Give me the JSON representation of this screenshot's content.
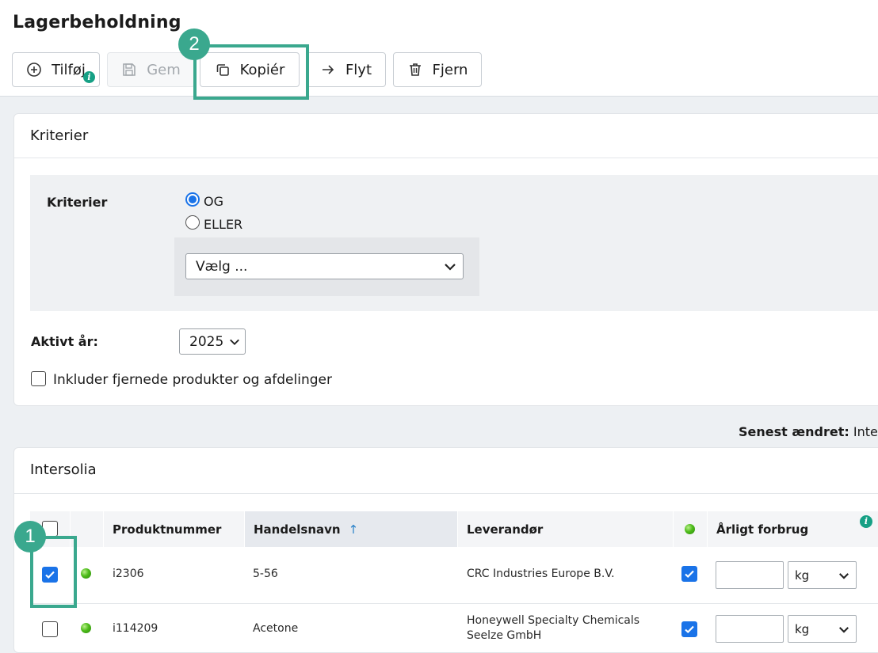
{
  "page": {
    "title": "Lagerbeholdning"
  },
  "toolbar": {
    "add_label": "Tilføj",
    "save_label": "Gem",
    "copy_label": "Kopiér",
    "move_label": "Flyt",
    "remove_label": "Fjern",
    "info_glyph": "i"
  },
  "callouts": {
    "copy": "2",
    "checkbox": "1"
  },
  "criteria_card": {
    "header": "Kriterier",
    "criteria_label": "Kriterier",
    "radio_and": "OG",
    "radio_or": "ELLER",
    "radio_selected": "OG",
    "select_placeholder": "Vælg ...",
    "active_year_label": "Aktivt år:",
    "active_year_value": "2025",
    "include_removed_label": "Inkluder fjernede produkter og afdelinger",
    "include_removed_checked": false
  },
  "last_changed": {
    "label": "Senest ændret:",
    "value": "Inters"
  },
  "table_card": {
    "header": "Intersolia",
    "columns": {
      "product_number": "Produktnummer",
      "trade_name": "Handelsnavn",
      "supplier": "Leverandør",
      "annual_usage": "Årligt forbrug",
      "sort_arrow": "↑"
    },
    "info_glyph": "i",
    "rows": [
      {
        "selected": true,
        "status": "green",
        "product_number": "i2306",
        "trade_name": "5-56",
        "supplier_line1": "CRC Industries Europe B.V.",
        "supplier_line2": "",
        "active": true,
        "usage": "",
        "unit": "kg"
      },
      {
        "selected": false,
        "status": "green",
        "product_number": "i114209",
        "trade_name": "Acetone",
        "supplier_line1": "Honeywell Specialty Chemicals",
        "supplier_line2": "Seelze GmbH",
        "active": true,
        "usage": "",
        "unit": "kg"
      }
    ]
  },
  "colors": {
    "accent": "#1a73e8",
    "callout": "#3aa88e",
    "info": "#16a085",
    "status_green": "#4dbb1a"
  }
}
